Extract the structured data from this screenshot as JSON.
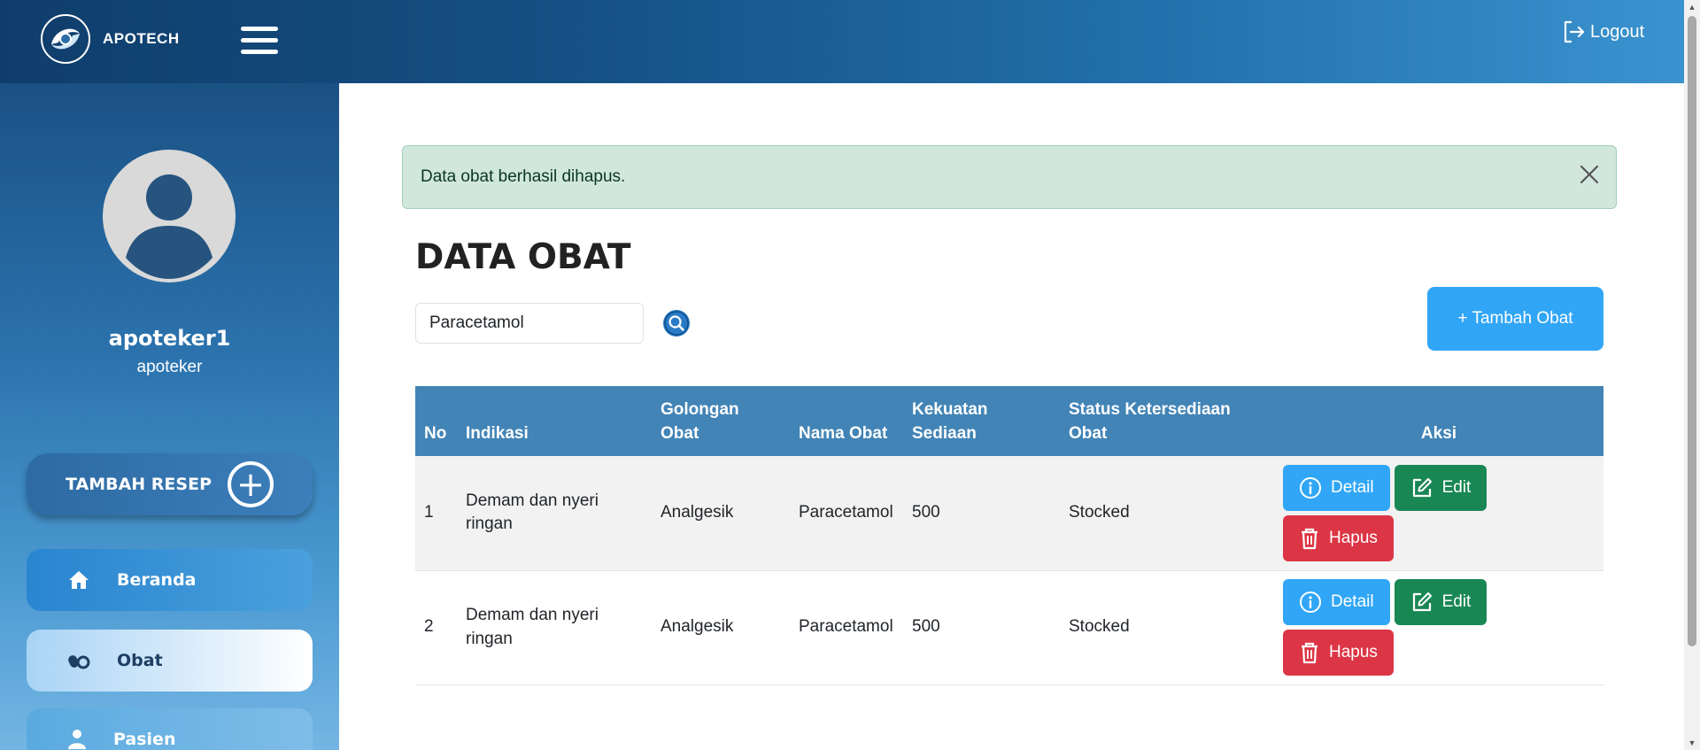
{
  "header": {
    "brand_name": "APOTECH",
    "logout_label": "Logout"
  },
  "sidebar": {
    "user_name": "apoteker1",
    "user_role": "apoteker",
    "tambah_resep_label": "TAMBAH RESEP",
    "items": [
      {
        "label": "Beranda",
        "icon": "home-icon"
      },
      {
        "label": "Obat",
        "icon": "pills-icon"
      },
      {
        "label": "Pasien",
        "icon": "user-icon"
      }
    ]
  },
  "alert": {
    "message": "Data obat berhasil dihapus."
  },
  "main": {
    "title": "DATA OBAT",
    "search_value": "Paracetamol",
    "add_button_label": "+ Tambah Obat"
  },
  "table": {
    "headers": [
      "No",
      "Indikasi",
      "Golongan Obat",
      "Nama Obat",
      "Kekuatan Sediaan",
      "Status Ketersediaan Obat",
      "Aksi"
    ],
    "rows": [
      {
        "no": "1",
        "indikasi": "Demam dan nyeri ringan",
        "golongan": "Analgesik",
        "nama": "Paracetamol",
        "kekuatan": "500",
        "status": "Stocked"
      },
      {
        "no": "2",
        "indikasi": "Demam dan nyeri ringan",
        "golongan": "Analgesik",
        "nama": "Paracetamol",
        "kekuatan": "500",
        "status": "Stocked"
      }
    ],
    "actions": {
      "detail_label": "Detail",
      "edit_label": "Edit",
      "hapus_label": "Hapus"
    }
  },
  "colors": {
    "primary": "#31a6f6",
    "success": "#198754",
    "danger": "#dc3545",
    "table_header": "#4284b6",
    "alert_bg": "#d1e7dd"
  }
}
